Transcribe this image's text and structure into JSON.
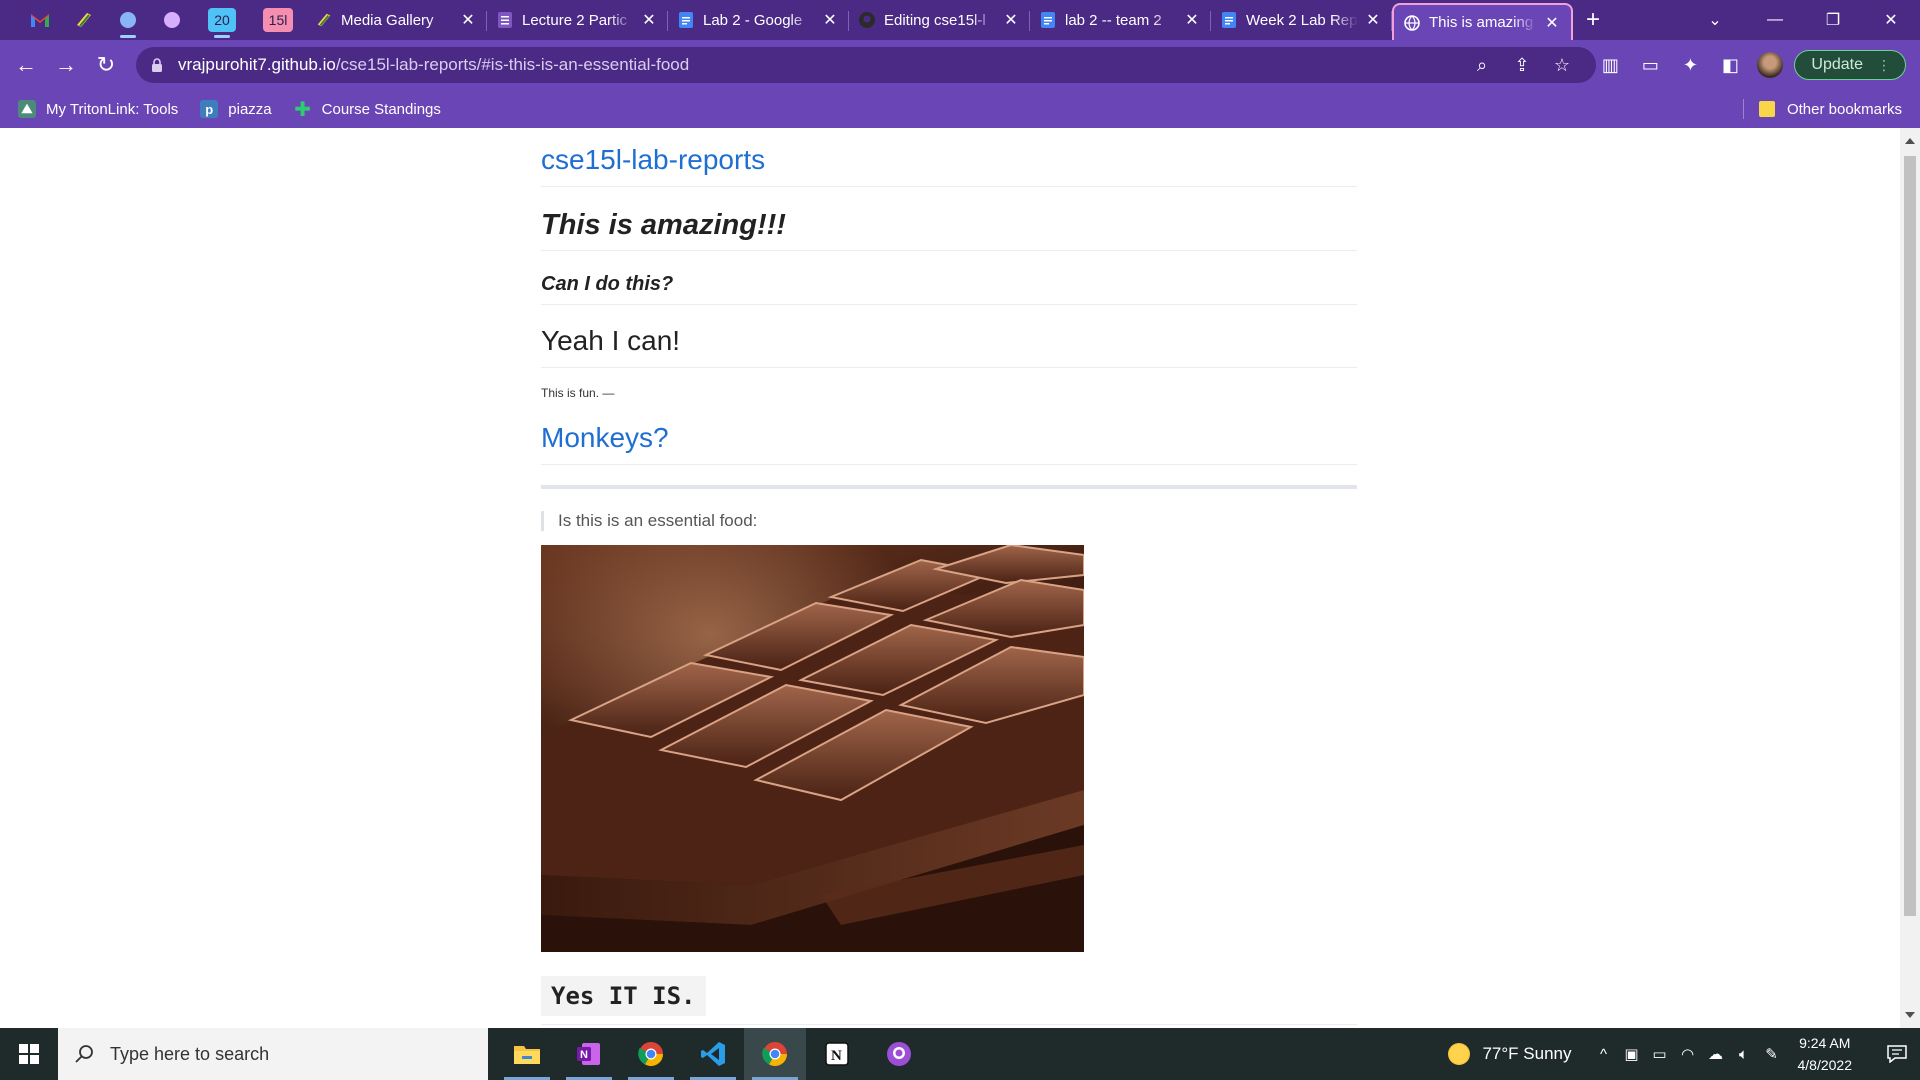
{
  "browser": {
    "pinned_badges": [
      {
        "label": "20",
        "color": "#4fc3f7"
      },
      {
        "label": "15l",
        "color": "#f48fb1"
      }
    ],
    "tabs": [
      {
        "title": "Media Gallery",
        "icon": "notability-icon"
      },
      {
        "title": "Lecture 2 Partic",
        "icon": "forms-icon"
      },
      {
        "title": "Lab 2 - Google",
        "icon": "docs-icon"
      },
      {
        "title": "Editing cse15l-l",
        "icon": "github-icon"
      },
      {
        "title": "lab 2 -- team 2",
        "icon": "docs-icon"
      },
      {
        "title": "Week 2 Lab Rep",
        "icon": "docs-icon"
      },
      {
        "title": "This is amazing",
        "icon": "globe-icon",
        "active": true
      }
    ],
    "url_host": "vrajpurohit7.github.io",
    "url_path": "/cse15l-lab-reports/#is-this-is-an-essential-food",
    "update_label": "Update",
    "bookmarks": [
      {
        "label": "My TritonLink: Tools"
      },
      {
        "label": "piazza"
      },
      {
        "label": "Course Standings"
      }
    ],
    "other_bookmarks": "Other bookmarks"
  },
  "page": {
    "site_title": "cse15l-lab-reports",
    "h1": "This is amazing!!!",
    "h3": "Can I do this?",
    "h2": "Yeah I can!",
    "small_text": "This is fun. —",
    "link_heading": "Monkeys?",
    "quote": "Is this is an essential food:",
    "code_text": "Yes IT IS."
  },
  "taskbar": {
    "search_placeholder": "Type here to search",
    "weather": "77°F  Sunny",
    "time": "9:24 AM",
    "date": "4/8/2022"
  },
  "colors": {
    "tabstrip": "#4b2a86",
    "toolbar": "#6a45b6",
    "link": "#1f6fd1",
    "taskbar": "#1f2b2b"
  }
}
